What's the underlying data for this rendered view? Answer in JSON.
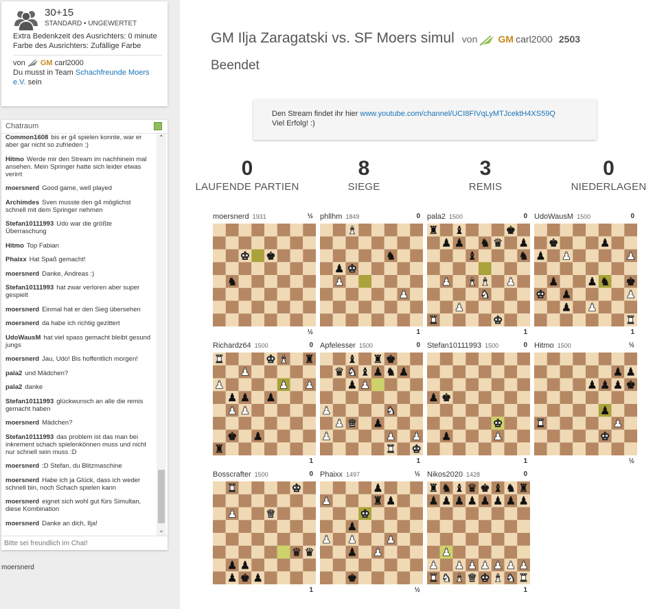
{
  "info": {
    "clock": "30+15",
    "variant": "STANDARD • UNGEWERTET",
    "extra_time": "Extra Bedenkzeit des Ausrichters: 0 minute",
    "host_color": "Farbe des Ausrichters: Zufällige Farbe",
    "by_label": "von",
    "host_title": "GM",
    "host_name": "carl2000",
    "team_pre": "Du musst in Team",
    "team_name": "Schachfreunde Moers e.V.",
    "team_post": "sein"
  },
  "chat": {
    "title": "Chatraum",
    "placeholder": "Bitte sei freundlich im Chat!",
    "messages": [
      {
        "user": "Common1608",
        "text": "bis er g4 spielen konnte, war er aber gar nicht so zufrieden :)"
      },
      {
        "user": "Hitmo",
        "text": "Werde mir den Stream im nachhinein mal ansehen. Mein Springer hatte sich leider etwas verirrt"
      },
      {
        "user": "moersnerd",
        "text": "Good game, well played"
      },
      {
        "user": "Archimdes",
        "text": "Sven musste den g4 möglichst schnell mit dem Springer nehmen"
      },
      {
        "user": "Stefan10111993",
        "text": "Udo war die größte Überraschung"
      },
      {
        "user": "Hitmo",
        "text": "Top Fabian"
      },
      {
        "user": "Phaixx",
        "text": "Hat Spaß gemacht!"
      },
      {
        "user": "moersnerd",
        "text": "Danke, Andreas :)"
      },
      {
        "user": "Stefan10111993",
        "text": "hat zwar verloren aber super gespielt"
      },
      {
        "user": "moersnerd",
        "text": "Einmal hat er den Sieg übersehen"
      },
      {
        "user": "moersnerd",
        "text": "da habe ich richtig gezittert"
      },
      {
        "user": "UdoWausM",
        "text": "hat viel spass gemacht bleibt gesund jungs"
      },
      {
        "user": "moersnerd",
        "text": "Jau, Udo! Bis hoffentlich morgen!"
      },
      {
        "user": "pala2",
        "text": "und Mädchen?"
      },
      {
        "user": "pala2",
        "text": "danke"
      },
      {
        "user": "Stefan10111993",
        "text": "glückwunsch an alle die remis gemacht haben"
      },
      {
        "user": "moersnerd",
        "text": "Mädchen?"
      },
      {
        "user": "Stefan10111993",
        "text": "das problem ist das man bei inkrement schach spielenkönnen muss und nicht nur schnell sein muss :D"
      },
      {
        "user": "moersnerd",
        "text": ":D Stefan, du Blitzmaschine"
      },
      {
        "user": "moersnerd",
        "text": "Habe ich ja Glück, dass ich weder schnell bin, noch Schach spielen kann"
      },
      {
        "user": "moersnerd",
        "text": "eignet sich wohl gut fürs Simultan, diese Kombination"
      },
      {
        "user": "moersnerd",
        "text": "Danke an dich, Ilja!"
      }
    ]
  },
  "spectator": "moersnerd",
  "simul": {
    "name": "GM Ilja Zaragatski vs. SF Moers simul",
    "by_label": "von",
    "host_title": "GM",
    "host_name": "carl2000",
    "host_rating": "2503",
    "status": "Beendet",
    "desc_pre": "Den Stream findet ihr hier",
    "desc_link": "www.youtube.com/channel/UCI8FIVqLyMTJcektH4XS59Q",
    "desc_line2": "Viel Erfolg! :)"
  },
  "stats": [
    {
      "value": "0",
      "label": "LAUFENDE PARTIEN"
    },
    {
      "value": "8",
      "label": "SIEGE"
    },
    {
      "value": "3",
      "label": "REMIS"
    },
    {
      "value": "0",
      "label": "NIEDERLAGEN"
    }
  ],
  "colors": {
    "light_square": "#f0d9b5",
    "dark_square": "#b58863",
    "highlight_light": "#cdd26a",
    "highlight_dark": "#aaa23a",
    "gm_gold": "#c68a1c",
    "link": "#1a73b8"
  },
  "games": [
    {
      "player": "moersnerd",
      "rating": "1931",
      "score": "½",
      "result": "½",
      "fen": "8/8/2K1k3/8/1n6/8/8/8",
      "highlight": [
        "d6"
      ]
    },
    {
      "player": "phllhm",
      "rating": "1849",
      "score": "0",
      "result": "1",
      "fen": "2B5/8/5n2/1pK5/1P6/6P1/8/8",
      "highlight": [
        "d4"
      ]
    },
    {
      "player": "pala2",
      "rating": "1500",
      "score": "0",
      "result": "1",
      "fen": "r1b3k1/1pp1nq1pp/3b3n1/8/1P1BB1P1/4N3/2P5/R4K2",
      "highlight": [
        "e5"
      ]
    },
    {
      "player": "UdoWausM",
      "rating": "1500",
      "score": "0",
      "result": "1",
      "fen": "8/1k3p2/p1P4P/8/1p2pn1k/K1p4P/2p1P3/7R",
      "highlight": [
        "f4"
      ]
    },
    {
      "player": "Richardz64",
      "rating": "1500",
      "score": "0",
      "result": "1",
      "fen": "R3KB1r/2P5/P4P1P/1pp1p3/1PP5/8/1k1p4/r7",
      "highlight": [
        "f6"
      ]
    },
    {
      "player": "Apfelesser",
      "rating": "1500",
      "score": "0",
      "result": "1",
      "fen": "2b1rk2/1qNbpnp1/2pP4/8/P4N2/1PQ1p3/P4P1P/5R1K",
      "highlight": [
        "e6"
      ]
    },
    {
      "player": "Stefan10111993",
      "rating": "1500",
      "score": "0",
      "result": "1",
      "fen": "8/8/8/pk6/8/5K2/1p3P2/8",
      "highlight": [
        "f3"
      ]
    },
    {
      "player": "Hitmo",
      "rating": "1500",
      "score": "½",
      "result": "½",
      "fen": "8/6pp/4pppk/8/5p2/R5P1/5K2/8",
      "highlight": [
        "f4"
      ]
    },
    {
      "player": "Bosscrafter",
      "rating": "1500",
      "score": "0",
      "result": "1",
      "fen": "1R4K1/8/1P2Q3/8/8/6qq/1pp5/1pkp4",
      "highlight": [
        "f3"
      ]
    },
    {
      "player": "Phaixx",
      "rating": "1497",
      "score": "½",
      "result": "½",
      "fen": "4p3/P3rp2/3K4/2p5/P1P2P2/2p1P3/8/2k5",
      "highlight": [
        "d6"
      ]
    },
    {
      "player": "Nikos2020",
      "rating": "1428",
      "score": "0",
      "result": "1",
      "fen": "rnbqkbnr/pppppppp/8/8/8/1P6/P1PPPPPP/RNBQKBNR",
      "highlight": [
        "b3"
      ]
    }
  ]
}
